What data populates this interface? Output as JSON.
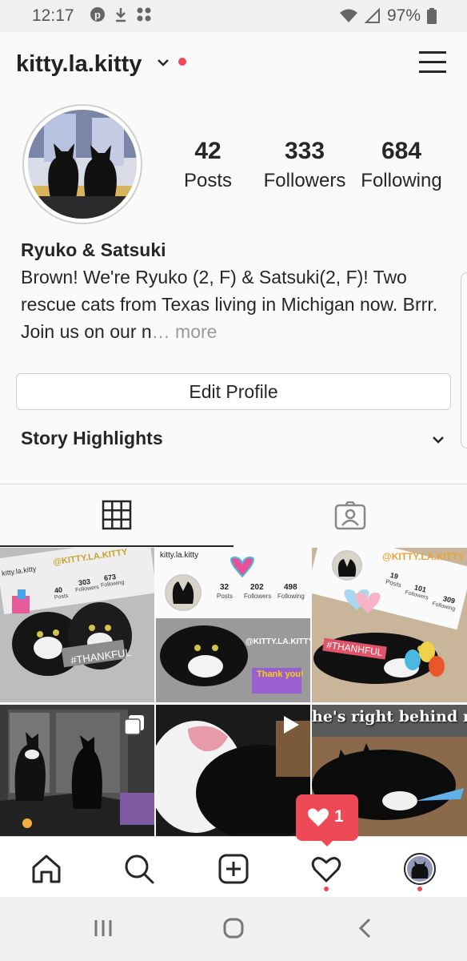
{
  "status_bar": {
    "time": "12:17",
    "battery": "97%"
  },
  "header": {
    "username": "kitty.la.kitty"
  },
  "stats": [
    {
      "value": "42",
      "label": "Posts"
    },
    {
      "value": "333",
      "label": "Followers"
    },
    {
      "value": "684",
      "label": "Following"
    }
  ],
  "bio": {
    "name": "Ryuko & Satsuki",
    "text": "Brown! We're Ryuko (2, F) & Satsuki(2, F)! Two rescue cats from Texas living in Michigan now. Brrr. Join us on our n",
    "ellipsis": "…",
    "more": " more"
  },
  "edit_profile_label": "Edit Profile",
  "highlights_label": "Story Highlights",
  "grid_overlays": {
    "post1_user": "kitty.la.kitty",
    "post1_handle": "@KITTY.LA.KITTY",
    "post1_stats": [
      "40",
      "303",
      "673"
    ],
    "post1_stat_labels": [
      "Posts",
      "Followers",
      "Following"
    ],
    "post1_tag": "#THANKFUL",
    "post2_user": "kitty.la.kitty",
    "post2_stats": [
      "32",
      "202",
      "498"
    ],
    "post2_stat_labels": [
      "Posts",
      "Followers",
      "Following"
    ],
    "post2_handle": "@KITTY.LA.KITTY",
    "post2_sticker": "Thank you!",
    "post3_handle": "@KITTY.LA.KITTY",
    "post3_stats": [
      "19",
      "101",
      "309"
    ],
    "post3_stat_labels": [
      "Posts",
      "Followers",
      "Following"
    ],
    "post3_tag": "#THANHFUL",
    "post6_caption": "he's right behind m"
  },
  "notification": {
    "count": "1"
  },
  "colors": {
    "accent": "#ed4956",
    "text": "#262626",
    "border": "#dbdbdb"
  }
}
